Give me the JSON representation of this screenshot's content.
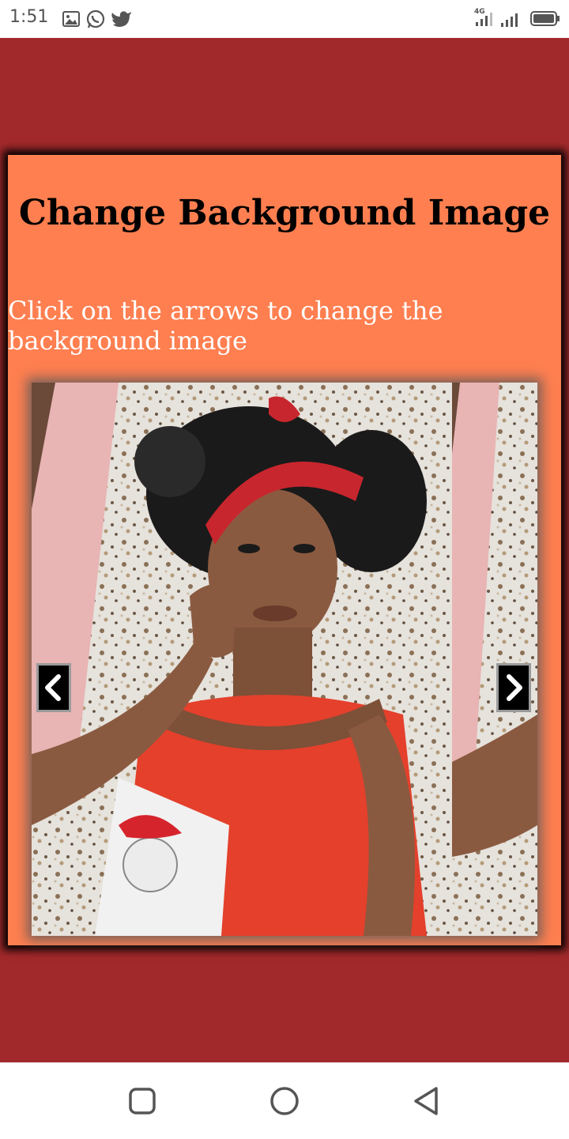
{
  "status_bar": {
    "time": "1:51",
    "icons": [
      "image-icon",
      "whatsapp-icon",
      "twitter-icon"
    ],
    "network": "4G",
    "right_icons": [
      "signal-4g-icon",
      "signal-icon",
      "battery-icon"
    ]
  },
  "card": {
    "title": "Change Background Image",
    "subtitle": "Click on the arrows to change the background image"
  },
  "viewer": {
    "prev_icon": "chevron-left-icon",
    "next_icon": "chevron-right-icon"
  },
  "nav_bar": {
    "icons": [
      "recent-apps-icon",
      "home-icon",
      "back-icon"
    ]
  },
  "colors": {
    "page_background": "#a2292b",
    "card_background": "#ff7f50",
    "title_text": "#000000",
    "subtitle_text": "#ffffff"
  }
}
